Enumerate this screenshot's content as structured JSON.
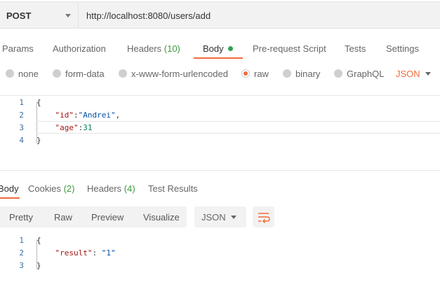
{
  "request": {
    "method": "POST",
    "url": "http://localhost:8080/users/add"
  },
  "tabs": {
    "params": "Params",
    "authorization": "Authorization",
    "headers": "Headers",
    "headers_count": "(10)",
    "body": "Body",
    "prerequest": "Pre-request Script",
    "tests": "Tests",
    "settings": "Settings"
  },
  "body_options": {
    "none": "none",
    "form_data": "form-data",
    "urlencoded": "x-www-form-urlencoded",
    "raw": "raw",
    "binary": "binary",
    "graphql": "GraphQL",
    "format": "JSON"
  },
  "request_body": {
    "line_numbers": [
      "1",
      "2",
      "3",
      "4"
    ],
    "open_brace": "{",
    "close_brace": "}",
    "key_id": "\"id\"",
    "val_id": "\"Andrei\"",
    "key_age": "\"age\"",
    "val_age": "31"
  },
  "response_tabs": {
    "body": "Body",
    "cookies": "Cookies",
    "cookies_count": "(2)",
    "headers": "Headers",
    "headers_count": "(4)",
    "test_results": "Test Results"
  },
  "view": {
    "pretty": "Pretty",
    "raw": "Raw",
    "preview": "Preview",
    "visualize": "Visualize",
    "format": "JSON"
  },
  "response_body": {
    "line_numbers": [
      "1",
      "2",
      "3"
    ],
    "open_brace": "{",
    "close_brace": "}",
    "key_result": "\"result\"",
    "val_result": "\"1\""
  },
  "colors": {
    "accent": "#f26b3a",
    "count_green": "#3d9a3d",
    "dot_green": "#2ea44f"
  }
}
